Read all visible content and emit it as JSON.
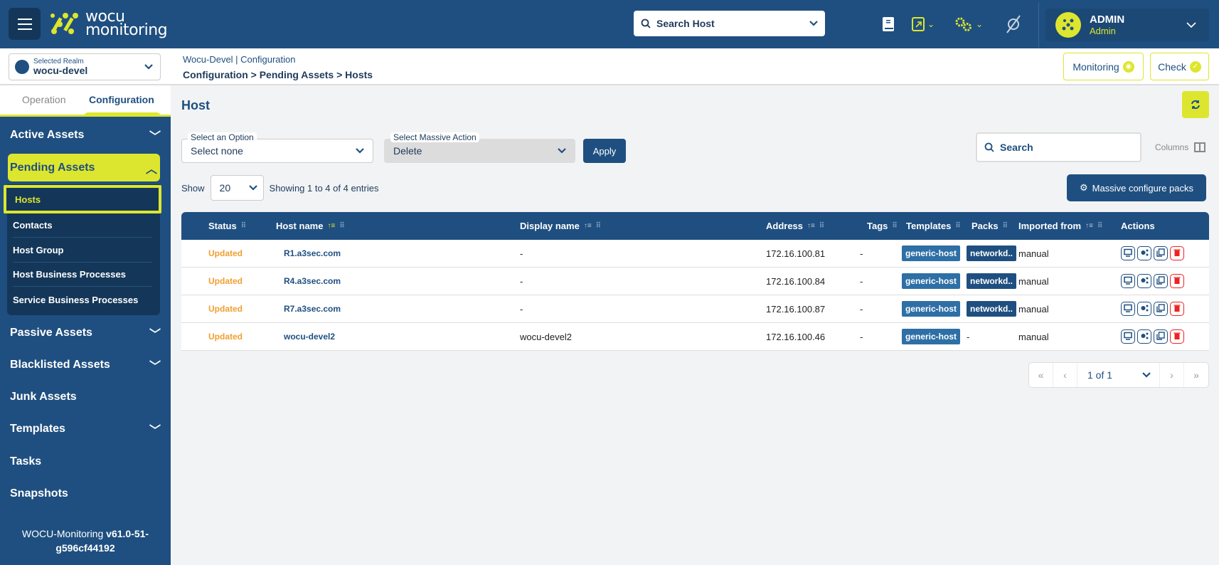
{
  "colors": {
    "primary": "#1f4f80",
    "accent": "#dde62e",
    "status_updated": "#f0a030",
    "danger": "#e22222"
  },
  "header": {
    "logo_line1": "wocu",
    "logo_line2": "monitoring",
    "search_placeholder": "Search Host",
    "icons": [
      "book-icon",
      "external-link-icon",
      "gears-icon",
      "plugin-off-icon"
    ],
    "user": {
      "name": "ADMIN",
      "role": "Admin"
    }
  },
  "realm": {
    "label": "Selected Realm",
    "value": "wocu-devel"
  },
  "breadcrumb": {
    "context": "Wocu-Devel | Configuration",
    "path": "Configuration > Pending Assets > Hosts"
  },
  "topbuttons": {
    "monitoring": "Monitoring",
    "check": "Check"
  },
  "sidebar": {
    "tabs": [
      {
        "label": "Operation"
      },
      {
        "label": "Configuration"
      }
    ],
    "items": [
      {
        "label": "Active Assets"
      },
      {
        "label": "Pending Assets"
      },
      {
        "label": "Passive Assets"
      },
      {
        "label": "Blacklisted Assets"
      },
      {
        "label": "Junk Assets"
      },
      {
        "label": "Templates"
      },
      {
        "label": "Tasks"
      },
      {
        "label": "Snapshots"
      }
    ],
    "subitems": [
      {
        "label": "Hosts"
      },
      {
        "label": "Contacts"
      },
      {
        "label": "Host Group"
      },
      {
        "label": "Host Business Processes"
      },
      {
        "label": "Service Business Processes"
      }
    ],
    "version_prefix": "WOCU-Monitoring ",
    "version": "v61.0-51-g596cf44192"
  },
  "main": {
    "title": "Host",
    "option_label": "Select an Option",
    "option_value": "Select none",
    "massive_label": "Select Massive Action",
    "massive_value": "Delete",
    "apply": "Apply",
    "search_placeholder": "Search",
    "columns": "Columns",
    "show": "Show",
    "page_size": "20",
    "showing": "Showing 1 to 4 of 4 entries",
    "massive_configure": "Massive configure packs",
    "pagination": "1 of 1"
  },
  "table": {
    "columns": [
      "Status",
      "Host name",
      "Display name",
      "Address",
      "Tags",
      "Templates",
      "Packs",
      "Imported from",
      "Actions"
    ],
    "rows": [
      {
        "status": "Updated",
        "host": "R1.a3sec.com",
        "display": "-",
        "address": "172.16.100.81",
        "tags": "-",
        "template": "generic-host",
        "pack": "networkd..",
        "imported": "manual"
      },
      {
        "status": "Updated",
        "host": "R4.a3sec.com",
        "display": "-",
        "address": "172.16.100.84",
        "tags": "-",
        "template": "generic-host",
        "pack": "networkd..",
        "imported": "manual"
      },
      {
        "status": "Updated",
        "host": "R7.a3sec.com",
        "display": "-",
        "address": "172.16.100.87",
        "tags": "-",
        "template": "generic-host",
        "pack": "networkd..",
        "imported": "manual"
      },
      {
        "status": "Updated",
        "host": "wocu-devel2",
        "display": "wocu-devel2",
        "address": "172.16.100.46",
        "tags": "-",
        "template": "generic-host",
        "pack": "-",
        "imported": "manual"
      }
    ]
  }
}
